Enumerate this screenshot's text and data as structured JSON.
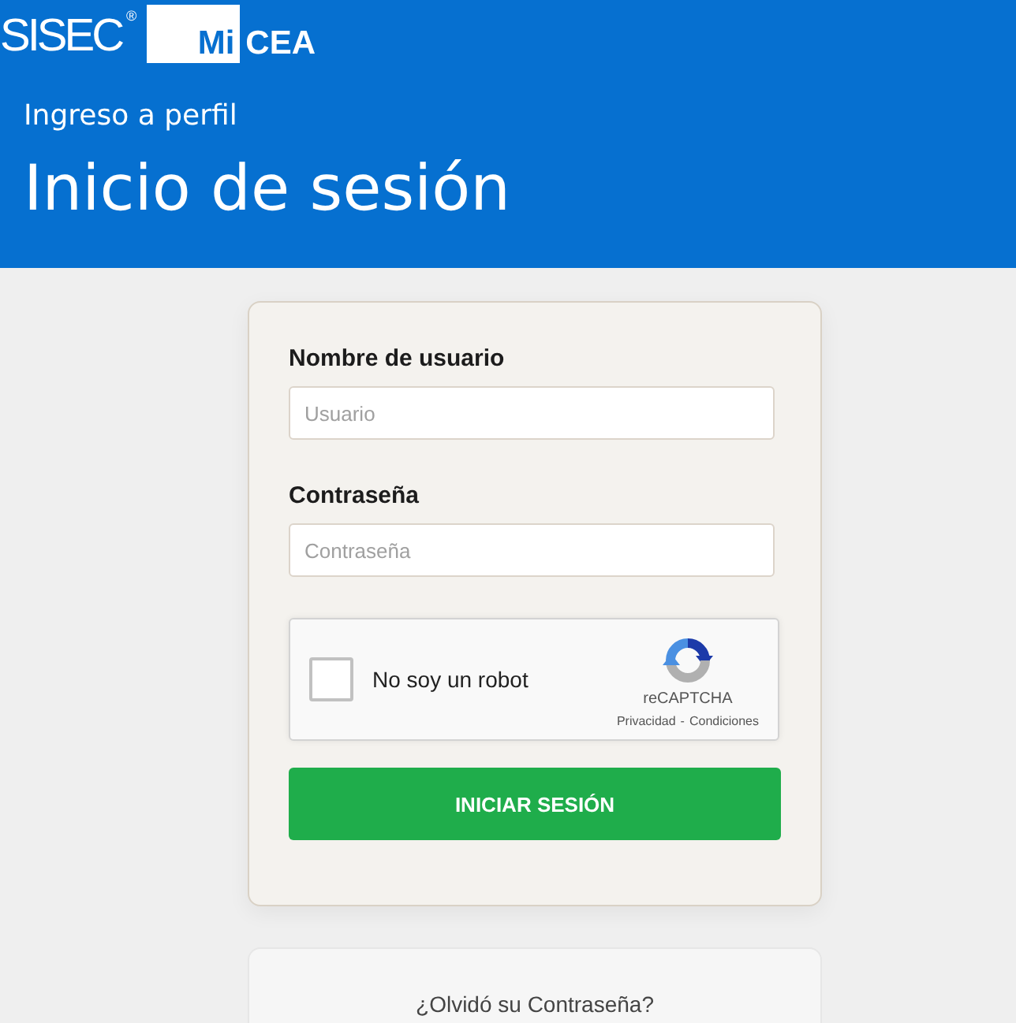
{
  "header": {
    "logo": {
      "brand": "SISEC",
      "registered_mark": "®",
      "badge": "Mi",
      "suffix": "CEA"
    },
    "subtitle": "Ingreso a perfil",
    "title": "Inicio de sesión"
  },
  "login_form": {
    "fields": [
      {
        "label": "Nombre de usuario",
        "placeholder": "Usuario"
      },
      {
        "label": "Contraseña",
        "placeholder": "Contraseña"
      }
    ],
    "captcha": {
      "checked": false,
      "label": "No soy un robot",
      "brand": "reCAPTCHA",
      "links": [
        "Privacidad",
        "Condiciones"
      ],
      "separator": "-"
    },
    "submit_button": "INICIAR SESIÓN"
  },
  "forgot_password": {
    "link": "¿Olvidó su Contraseña?"
  }
}
